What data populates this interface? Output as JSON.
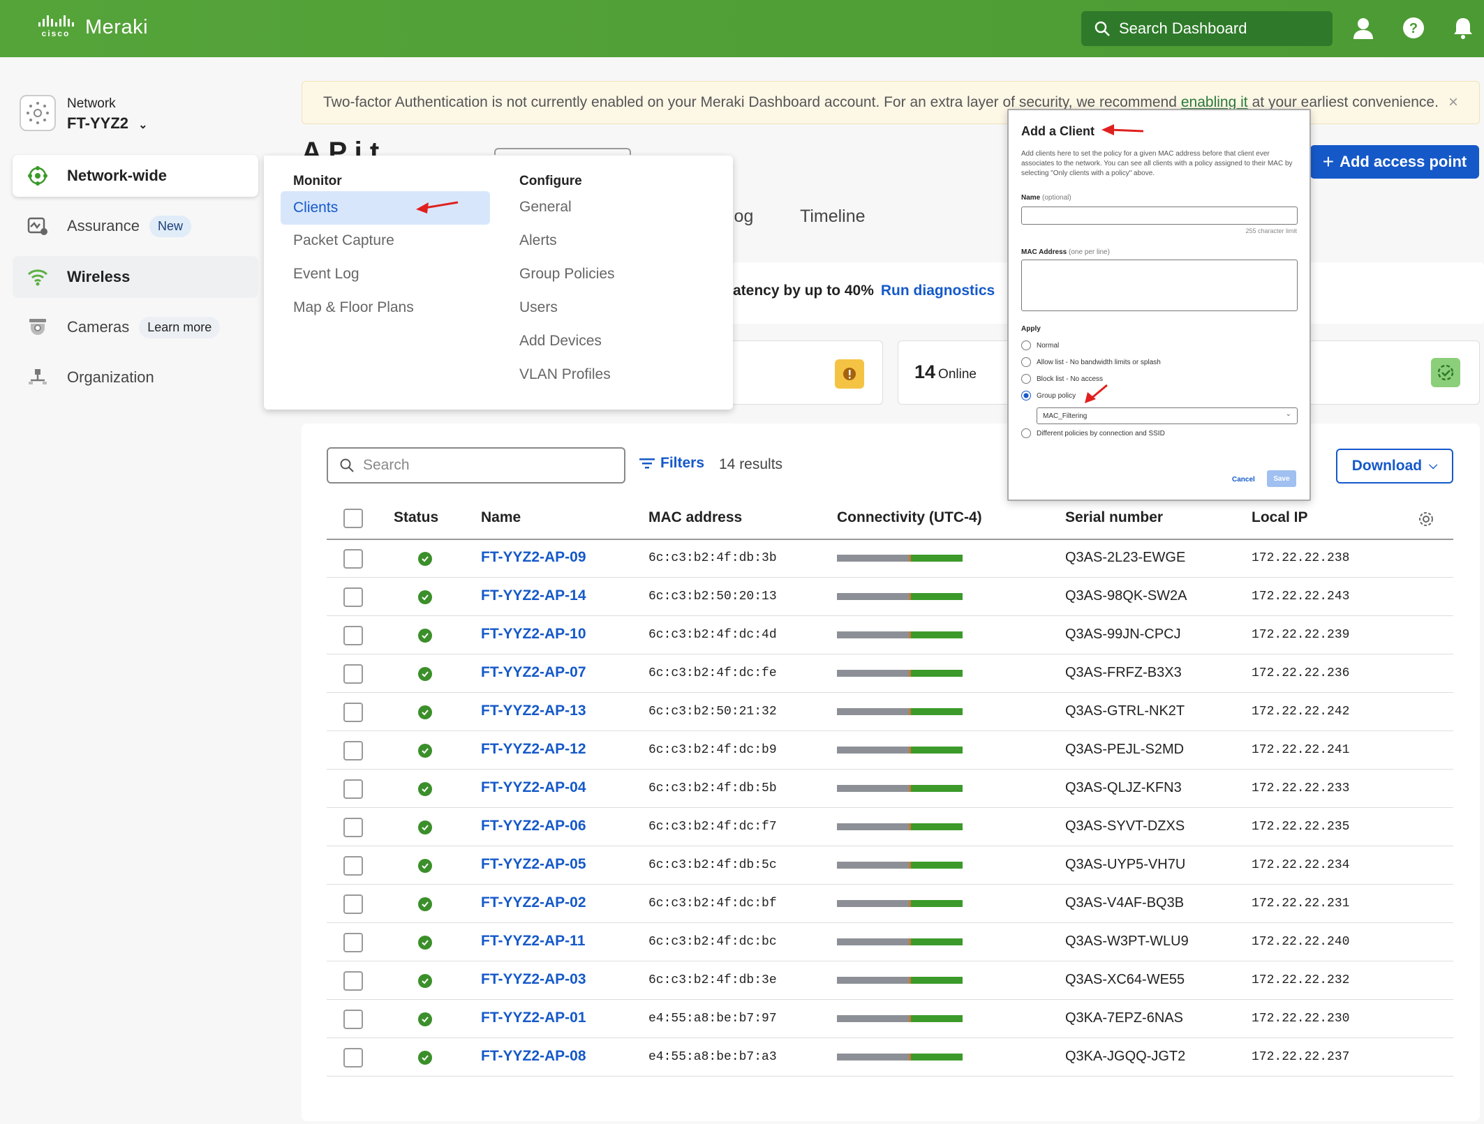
{
  "topbar": {
    "brand": "Meraki",
    "cisco": "cisco",
    "search_placeholder": "Search Dashboard"
  },
  "sidebar": {
    "network_label": "Network",
    "network_name": "FT-YYZ2",
    "items": [
      {
        "label": "Network-wide"
      },
      {
        "label": "Assurance",
        "badge": "New"
      },
      {
        "label": "Wireless"
      },
      {
        "label": "Cameras",
        "badge": "Learn more"
      },
      {
        "label": "Organization"
      }
    ]
  },
  "banner": {
    "text_before": "Two-factor Authentication is not currently enabled on your Meraki Dashboard account. For an extra layer of security, we recommend",
    "link": "enabling it",
    "text_after": "at your earliest convenience.",
    "close": "×"
  },
  "page": {
    "title_fragment": "A      P   i t",
    "add_button": "Add access point",
    "tab_log_fragment": "log",
    "tab_timeline": "Timeline",
    "diag_text": "atency by up to 40%",
    "diag_link": "Run diagnostics",
    "online_count": "14",
    "online_label": "Online"
  },
  "menu": {
    "monitor_heading": "Monitor",
    "monitor_items": [
      "Clients",
      "Packet Capture",
      "Event Log",
      "Map & Floor Plans"
    ],
    "configure_heading": "Configure",
    "configure_items": [
      "General",
      "Alerts",
      "Group Policies",
      "Users",
      "Add Devices",
      "VLAN Profiles"
    ]
  },
  "table": {
    "search_placeholder": "Search",
    "filters_label": "Filters",
    "results": "14 results",
    "download_label": "Download",
    "headers": [
      "Status",
      "Name",
      "MAC address",
      "Connectivity (UTC-4)",
      "Serial number",
      "Local IP"
    ],
    "rows": [
      {
        "name": "FT-YYZ2-AP-09",
        "mac": "6c:c3:b2:4f:db:3b",
        "serial": "Q3AS-2L23-EWGE",
        "ip": "172.22.22.238"
      },
      {
        "name": "FT-YYZ2-AP-14",
        "mac": "6c:c3:b2:50:20:13",
        "serial": "Q3AS-98QK-SW2A",
        "ip": "172.22.22.243"
      },
      {
        "name": "FT-YYZ2-AP-10",
        "mac": "6c:c3:b2:4f:dc:4d",
        "serial": "Q3AS-99JN-CPCJ",
        "ip": "172.22.22.239"
      },
      {
        "name": "FT-YYZ2-AP-07",
        "mac": "6c:c3:b2:4f:dc:fe",
        "serial": "Q3AS-FRFZ-B3X3",
        "ip": "172.22.22.236"
      },
      {
        "name": "FT-YYZ2-AP-13",
        "mac": "6c:c3:b2:50:21:32",
        "serial": "Q3AS-GTRL-NK2T",
        "ip": "172.22.22.242"
      },
      {
        "name": "FT-YYZ2-AP-12",
        "mac": "6c:c3:b2:4f:dc:b9",
        "serial": "Q3AS-PEJL-S2MD",
        "ip": "172.22.22.241"
      },
      {
        "name": "FT-YYZ2-AP-04",
        "mac": "6c:c3:b2:4f:db:5b",
        "serial": "Q3AS-QLJZ-KFN3",
        "ip": "172.22.22.233"
      },
      {
        "name": "FT-YYZ2-AP-06",
        "mac": "6c:c3:b2:4f:dc:f7",
        "serial": "Q3AS-SYVT-DZXS",
        "ip": "172.22.22.235"
      },
      {
        "name": "FT-YYZ2-AP-05",
        "mac": "6c:c3:b2:4f:db:5c",
        "serial": "Q3AS-UYP5-VH7U",
        "ip": "172.22.22.234"
      },
      {
        "name": "FT-YYZ2-AP-02",
        "mac": "6c:c3:b2:4f:dc:bf",
        "serial": "Q3AS-V4AF-BQ3B",
        "ip": "172.22.22.231"
      },
      {
        "name": "FT-YYZ2-AP-11",
        "mac": "6c:c3:b2:4f:dc:bc",
        "serial": "Q3AS-W3PT-WLU9",
        "ip": "172.22.22.240"
      },
      {
        "name": "FT-YYZ2-AP-03",
        "mac": "6c:c3:b2:4f:db:3e",
        "serial": "Q3AS-XC64-WE55",
        "ip": "172.22.22.232"
      },
      {
        "name": "FT-YYZ2-AP-01",
        "mac": "e4:55:a8:be:b7:97",
        "serial": "Q3KA-7EPZ-6NAS",
        "ip": "172.22.22.230"
      },
      {
        "name": "FT-YYZ2-AP-08",
        "mac": "e4:55:a8:be:b7:a3",
        "serial": "Q3KA-JGQQ-JGT2",
        "ip": "172.22.22.237"
      }
    ]
  },
  "modal": {
    "title": "Add a Client",
    "description": "Add clients here to set the policy for a given MAC address before that client ever associates to the network. You can see all clients with a policy assigned to their MAC by selecting \"Only clients with a policy\" above.",
    "name_label": "Name",
    "name_hint": "(optional)",
    "char_limit": "255 character limit",
    "mac_label": "MAC Address",
    "mac_hint": "(one per line)",
    "apply_label": "Apply",
    "options": [
      "Normal",
      "Allow list - No bandwidth limits or splash",
      "Block list - No access",
      "Group policy",
      "Different policies by connection and SSID"
    ],
    "selected_option": "Group policy",
    "group_policy_value": "MAC_Filtering",
    "cancel": "Cancel",
    "save": "Save"
  },
  "colors": {
    "brand_green": "#4c9a33",
    "link_blue": "#1559c9",
    "annotation_red": "#e0201e"
  }
}
